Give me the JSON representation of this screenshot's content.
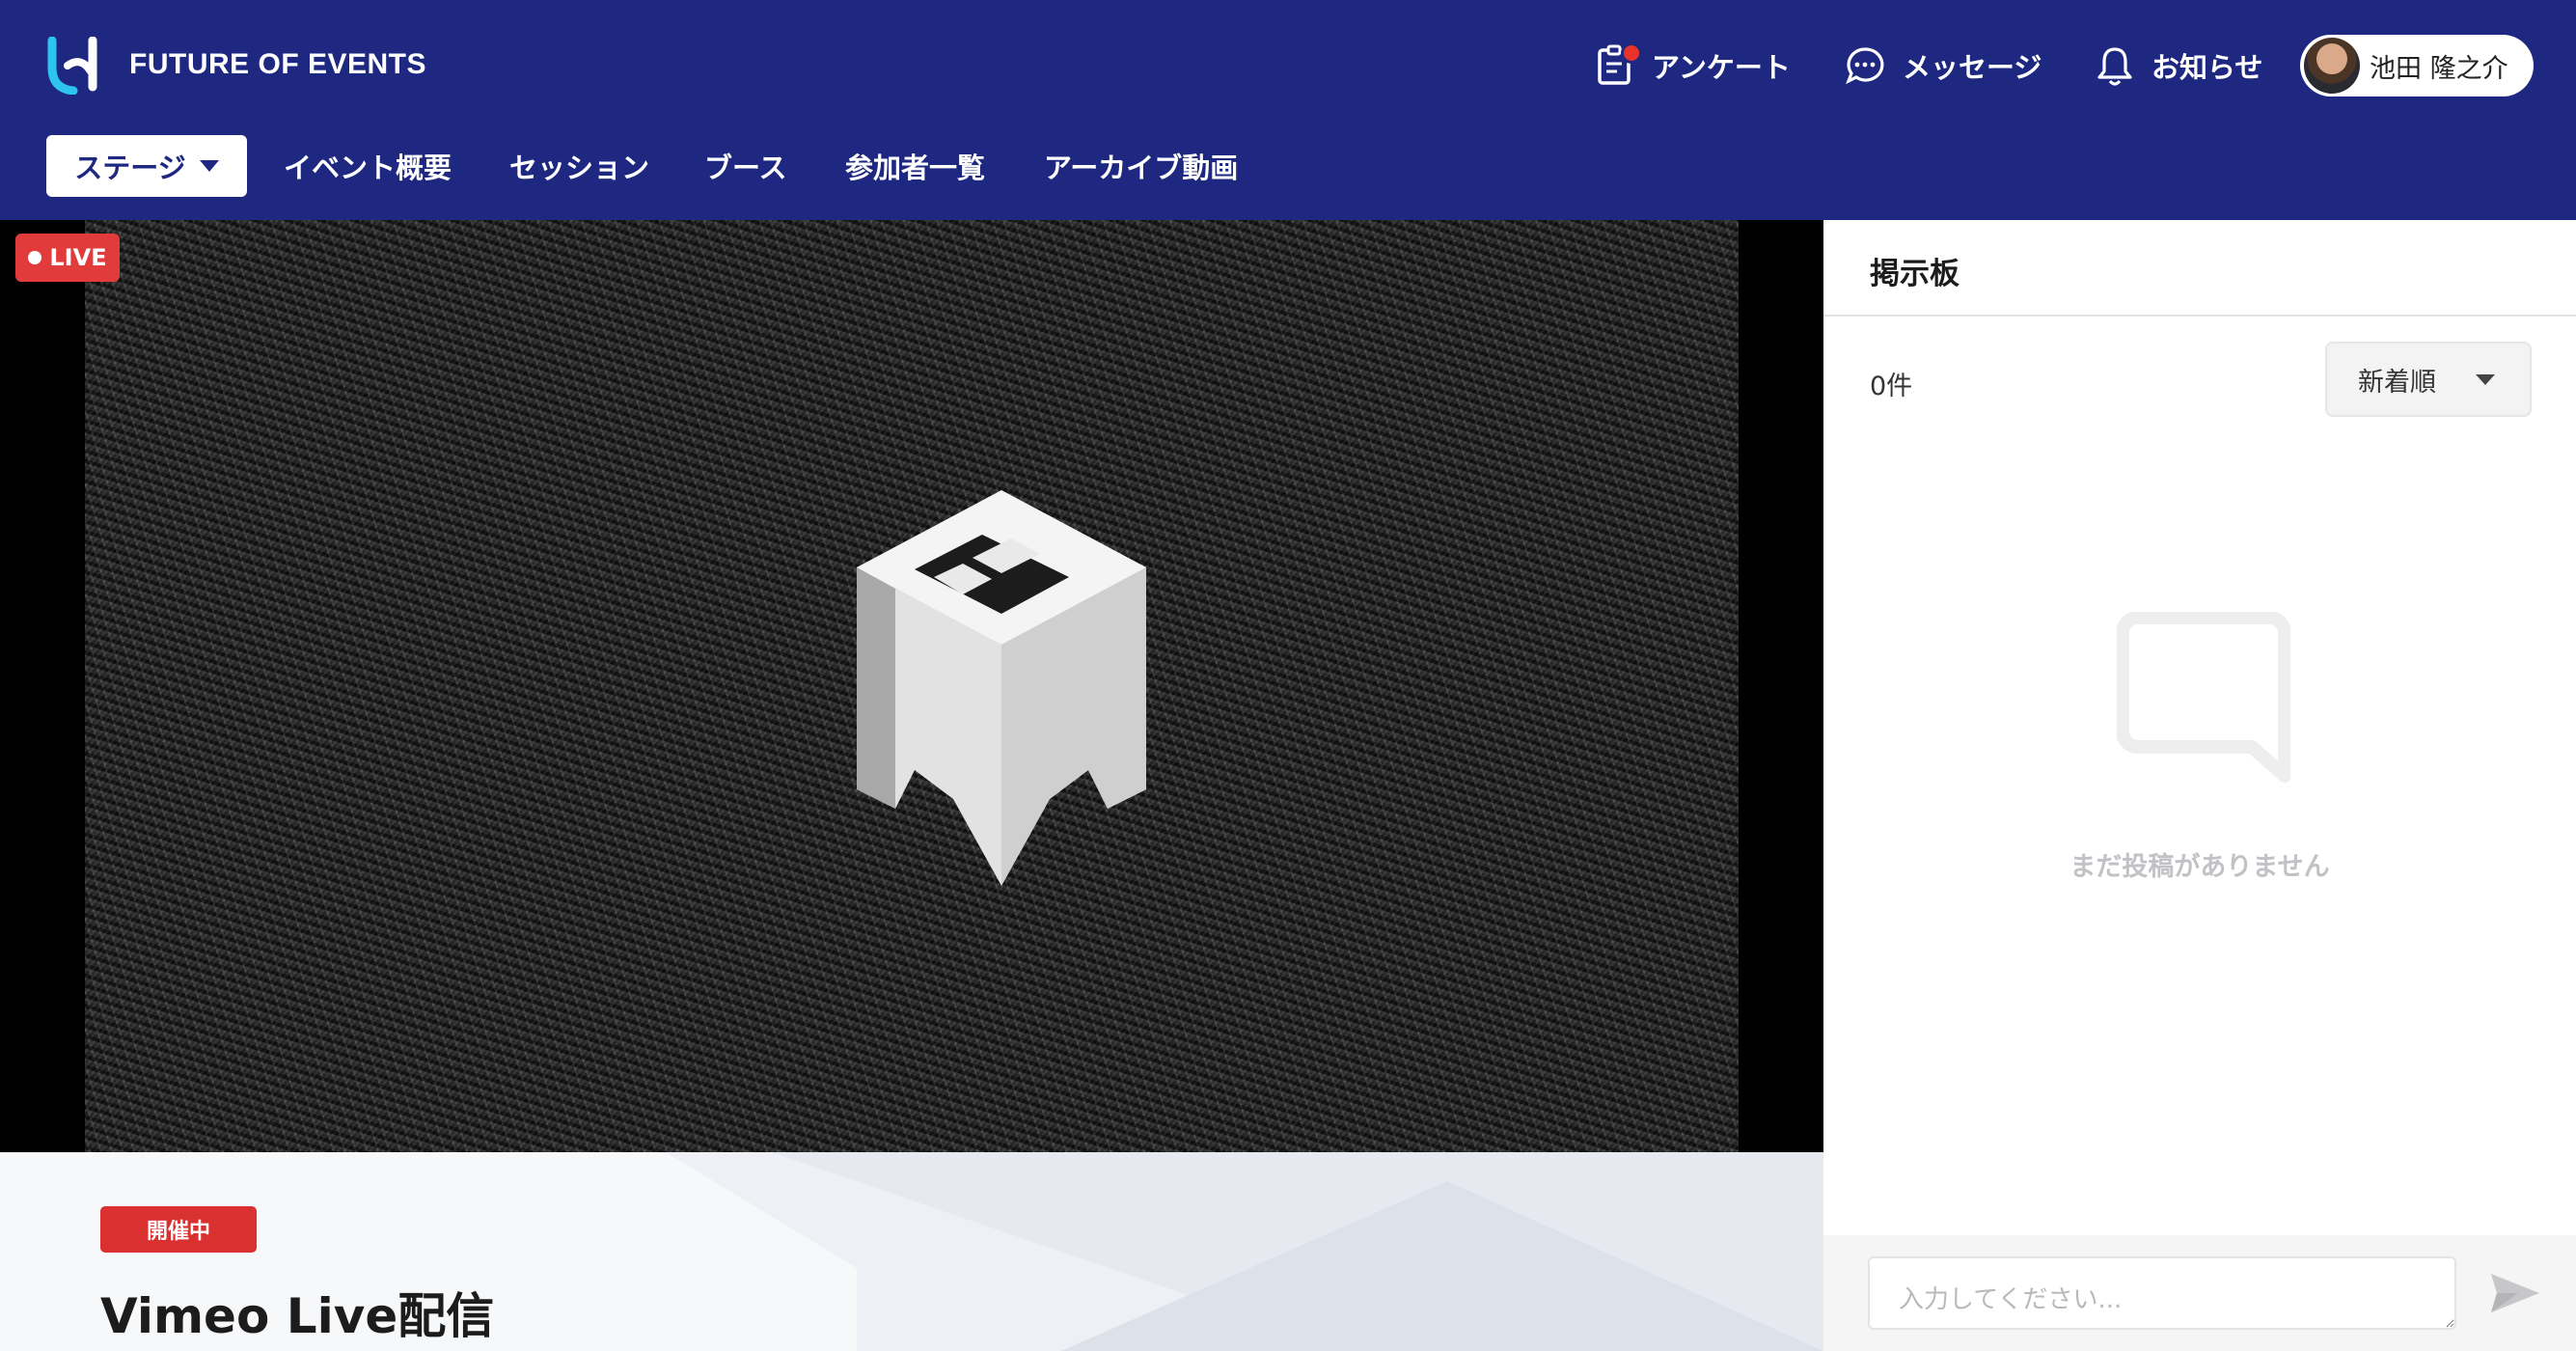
{
  "header": {
    "brand": "FUTURE OF EVENTS",
    "actions": {
      "survey": "アンケート",
      "messages": "メッセージ",
      "notifications": "お知らせ"
    },
    "user": {
      "name": "池田 隆之介"
    }
  },
  "nav": {
    "active": "ステージ",
    "items": [
      "イベント概要",
      "セッション",
      "ブース",
      "参加者一覧",
      "アーカイブ動画"
    ]
  },
  "video": {
    "live_label": "LIVE"
  },
  "event": {
    "status": "開催中",
    "title": "Vimeo Live配信"
  },
  "board": {
    "title": "掲示板",
    "count": "0件",
    "sort": "新着順",
    "empty": "まだ投稿がありません",
    "input_placeholder": "入力してください..."
  },
  "colors": {
    "header_bg": "#1e2880",
    "live_red": "#e23b3b",
    "status_red": "#d93030"
  },
  "icons": [
    "logo-icon",
    "survey-icon",
    "message-icon",
    "bell-icon",
    "chevron-down-icon",
    "empty-chat-icon",
    "send-icon"
  ]
}
